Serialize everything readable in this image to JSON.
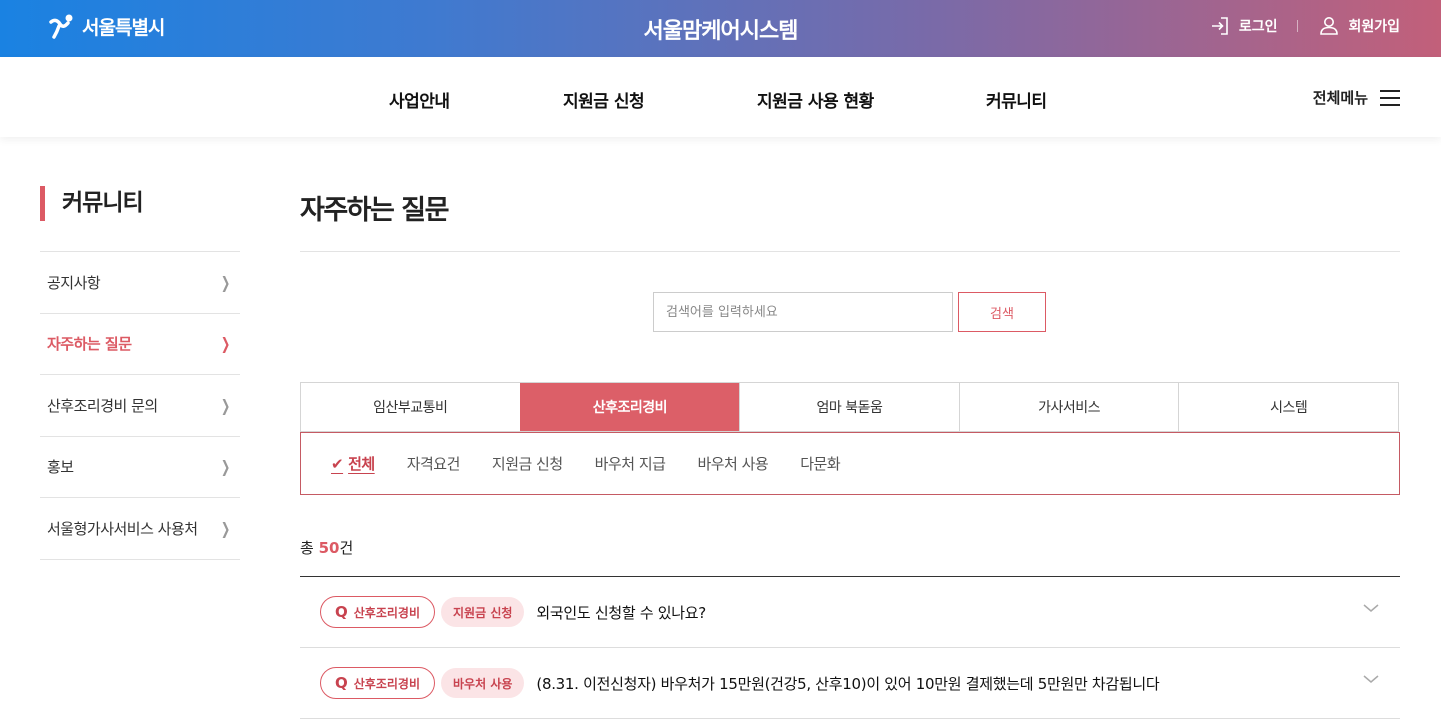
{
  "header": {
    "logo_text": "서울특별시",
    "site_title": "서울맘케어시스템",
    "login_label": "로그인",
    "signup_label": "회원가입"
  },
  "gnb": {
    "items": [
      "사업안내",
      "지원금 신청",
      "지원금 사용 현황",
      "커뮤니티"
    ],
    "all_menu_label": "전체메뉴"
  },
  "sidebar": {
    "title": "커뮤니티",
    "items": [
      {
        "label": "공지사항"
      },
      {
        "label": "자주하는 질문",
        "active": true
      },
      {
        "label": "산후조리경비 문의"
      },
      {
        "label": "홍보"
      },
      {
        "label": "서울형가사서비스 사용처"
      }
    ]
  },
  "main": {
    "title": "자주하는 질문",
    "search": {
      "placeholder": "검색어를 입력하세요",
      "value": "",
      "button_label": "검색"
    },
    "tabs": [
      "임산부교통비",
      "산후조리경비",
      "엄마 북돋움",
      "가사서비스",
      "시스템"
    ],
    "active_tab": "산후조리경비",
    "subtabs": [
      "전체",
      "자격요건",
      "지원금 신청",
      "바우처 지급",
      "바우처 사용",
      "다문화"
    ],
    "active_subtab": "전체",
    "total": {
      "prefix": "총 ",
      "count": "50",
      "suffix": "건"
    },
    "faq": [
      {
        "badge": "산후조리경비",
        "category": "지원금 신청",
        "question": "외국인도 신청할 수 있나요?"
      },
      {
        "badge": "산후조리경비",
        "category": "바우처 사용",
        "question": "(8.31. 이전신청자) 바우처가 15만원(건강5, 산후10)이 있어 10만원 결제했는데 5만원만 차감됩니다"
      }
    ]
  },
  "colors": {
    "accent": "#dc5a64",
    "gradient_start": "#1a82e2",
    "gradient_end": "#c2607a"
  },
  "icons": [
    "seoul-logo-icon",
    "login-icon",
    "user-icon",
    "hamburger-icon",
    "chevron-right-icon",
    "check-icon",
    "chevron-down-icon"
  ]
}
